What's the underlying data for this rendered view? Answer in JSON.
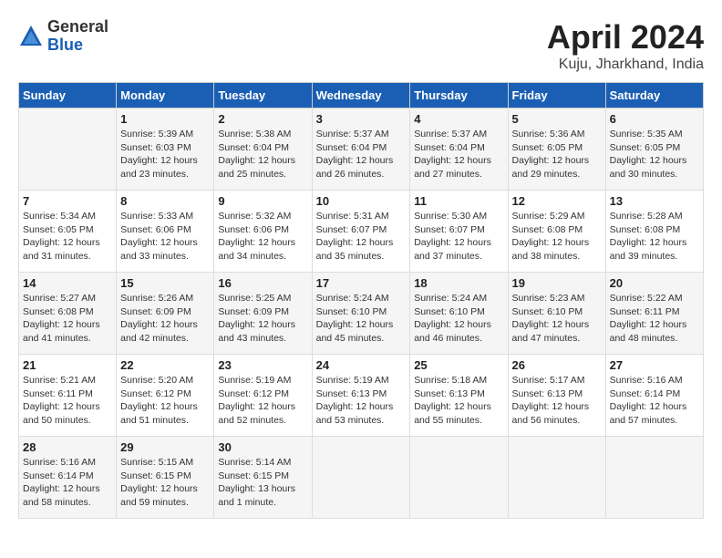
{
  "logo": {
    "general": "General",
    "blue": "Blue"
  },
  "title": {
    "month": "April 2024",
    "location": "Kuju, Jharkhand, India"
  },
  "headers": [
    "Sunday",
    "Monday",
    "Tuesday",
    "Wednesday",
    "Thursday",
    "Friday",
    "Saturday"
  ],
  "weeks": [
    [
      {
        "day": "",
        "sunrise": "",
        "sunset": "",
        "daylight": ""
      },
      {
        "day": "1",
        "sunrise": "Sunrise: 5:39 AM",
        "sunset": "Sunset: 6:03 PM",
        "daylight": "Daylight: 12 hours and 23 minutes."
      },
      {
        "day": "2",
        "sunrise": "Sunrise: 5:38 AM",
        "sunset": "Sunset: 6:04 PM",
        "daylight": "Daylight: 12 hours and 25 minutes."
      },
      {
        "day": "3",
        "sunrise": "Sunrise: 5:37 AM",
        "sunset": "Sunset: 6:04 PM",
        "daylight": "Daylight: 12 hours and 26 minutes."
      },
      {
        "day": "4",
        "sunrise": "Sunrise: 5:37 AM",
        "sunset": "Sunset: 6:04 PM",
        "daylight": "Daylight: 12 hours and 27 minutes."
      },
      {
        "day": "5",
        "sunrise": "Sunrise: 5:36 AM",
        "sunset": "Sunset: 6:05 PM",
        "daylight": "Daylight: 12 hours and 29 minutes."
      },
      {
        "day": "6",
        "sunrise": "Sunrise: 5:35 AM",
        "sunset": "Sunset: 6:05 PM",
        "daylight": "Daylight: 12 hours and 30 minutes."
      }
    ],
    [
      {
        "day": "7",
        "sunrise": "Sunrise: 5:34 AM",
        "sunset": "Sunset: 6:05 PM",
        "daylight": "Daylight: 12 hours and 31 minutes."
      },
      {
        "day": "8",
        "sunrise": "Sunrise: 5:33 AM",
        "sunset": "Sunset: 6:06 PM",
        "daylight": "Daylight: 12 hours and 33 minutes."
      },
      {
        "day": "9",
        "sunrise": "Sunrise: 5:32 AM",
        "sunset": "Sunset: 6:06 PM",
        "daylight": "Daylight: 12 hours and 34 minutes."
      },
      {
        "day": "10",
        "sunrise": "Sunrise: 5:31 AM",
        "sunset": "Sunset: 6:07 PM",
        "daylight": "Daylight: 12 hours and 35 minutes."
      },
      {
        "day": "11",
        "sunrise": "Sunrise: 5:30 AM",
        "sunset": "Sunset: 6:07 PM",
        "daylight": "Daylight: 12 hours and 37 minutes."
      },
      {
        "day": "12",
        "sunrise": "Sunrise: 5:29 AM",
        "sunset": "Sunset: 6:08 PM",
        "daylight": "Daylight: 12 hours and 38 minutes."
      },
      {
        "day": "13",
        "sunrise": "Sunrise: 5:28 AM",
        "sunset": "Sunset: 6:08 PM",
        "daylight": "Daylight: 12 hours and 39 minutes."
      }
    ],
    [
      {
        "day": "14",
        "sunrise": "Sunrise: 5:27 AM",
        "sunset": "Sunset: 6:08 PM",
        "daylight": "Daylight: 12 hours and 41 minutes."
      },
      {
        "day": "15",
        "sunrise": "Sunrise: 5:26 AM",
        "sunset": "Sunset: 6:09 PM",
        "daylight": "Daylight: 12 hours and 42 minutes."
      },
      {
        "day": "16",
        "sunrise": "Sunrise: 5:25 AM",
        "sunset": "Sunset: 6:09 PM",
        "daylight": "Daylight: 12 hours and 43 minutes."
      },
      {
        "day": "17",
        "sunrise": "Sunrise: 5:24 AM",
        "sunset": "Sunset: 6:10 PM",
        "daylight": "Daylight: 12 hours and 45 minutes."
      },
      {
        "day": "18",
        "sunrise": "Sunrise: 5:24 AM",
        "sunset": "Sunset: 6:10 PM",
        "daylight": "Daylight: 12 hours and 46 minutes."
      },
      {
        "day": "19",
        "sunrise": "Sunrise: 5:23 AM",
        "sunset": "Sunset: 6:10 PM",
        "daylight": "Daylight: 12 hours and 47 minutes."
      },
      {
        "day": "20",
        "sunrise": "Sunrise: 5:22 AM",
        "sunset": "Sunset: 6:11 PM",
        "daylight": "Daylight: 12 hours and 48 minutes."
      }
    ],
    [
      {
        "day": "21",
        "sunrise": "Sunrise: 5:21 AM",
        "sunset": "Sunset: 6:11 PM",
        "daylight": "Daylight: 12 hours and 50 minutes."
      },
      {
        "day": "22",
        "sunrise": "Sunrise: 5:20 AM",
        "sunset": "Sunset: 6:12 PM",
        "daylight": "Daylight: 12 hours and 51 minutes."
      },
      {
        "day": "23",
        "sunrise": "Sunrise: 5:19 AM",
        "sunset": "Sunset: 6:12 PM",
        "daylight": "Daylight: 12 hours and 52 minutes."
      },
      {
        "day": "24",
        "sunrise": "Sunrise: 5:19 AM",
        "sunset": "Sunset: 6:13 PM",
        "daylight": "Daylight: 12 hours and 53 minutes."
      },
      {
        "day": "25",
        "sunrise": "Sunrise: 5:18 AM",
        "sunset": "Sunset: 6:13 PM",
        "daylight": "Daylight: 12 hours and 55 minutes."
      },
      {
        "day": "26",
        "sunrise": "Sunrise: 5:17 AM",
        "sunset": "Sunset: 6:13 PM",
        "daylight": "Daylight: 12 hours and 56 minutes."
      },
      {
        "day": "27",
        "sunrise": "Sunrise: 5:16 AM",
        "sunset": "Sunset: 6:14 PM",
        "daylight": "Daylight: 12 hours and 57 minutes."
      }
    ],
    [
      {
        "day": "28",
        "sunrise": "Sunrise: 5:16 AM",
        "sunset": "Sunset: 6:14 PM",
        "daylight": "Daylight: 12 hours and 58 minutes."
      },
      {
        "day": "29",
        "sunrise": "Sunrise: 5:15 AM",
        "sunset": "Sunset: 6:15 PM",
        "daylight": "Daylight: 12 hours and 59 minutes."
      },
      {
        "day": "30",
        "sunrise": "Sunrise: 5:14 AM",
        "sunset": "Sunset: 6:15 PM",
        "daylight": "Daylight: 13 hours and 1 minute."
      },
      {
        "day": "",
        "sunrise": "",
        "sunset": "",
        "daylight": ""
      },
      {
        "day": "",
        "sunrise": "",
        "sunset": "",
        "daylight": ""
      },
      {
        "day": "",
        "sunrise": "",
        "sunset": "",
        "daylight": ""
      },
      {
        "day": "",
        "sunrise": "",
        "sunset": "",
        "daylight": ""
      }
    ]
  ]
}
